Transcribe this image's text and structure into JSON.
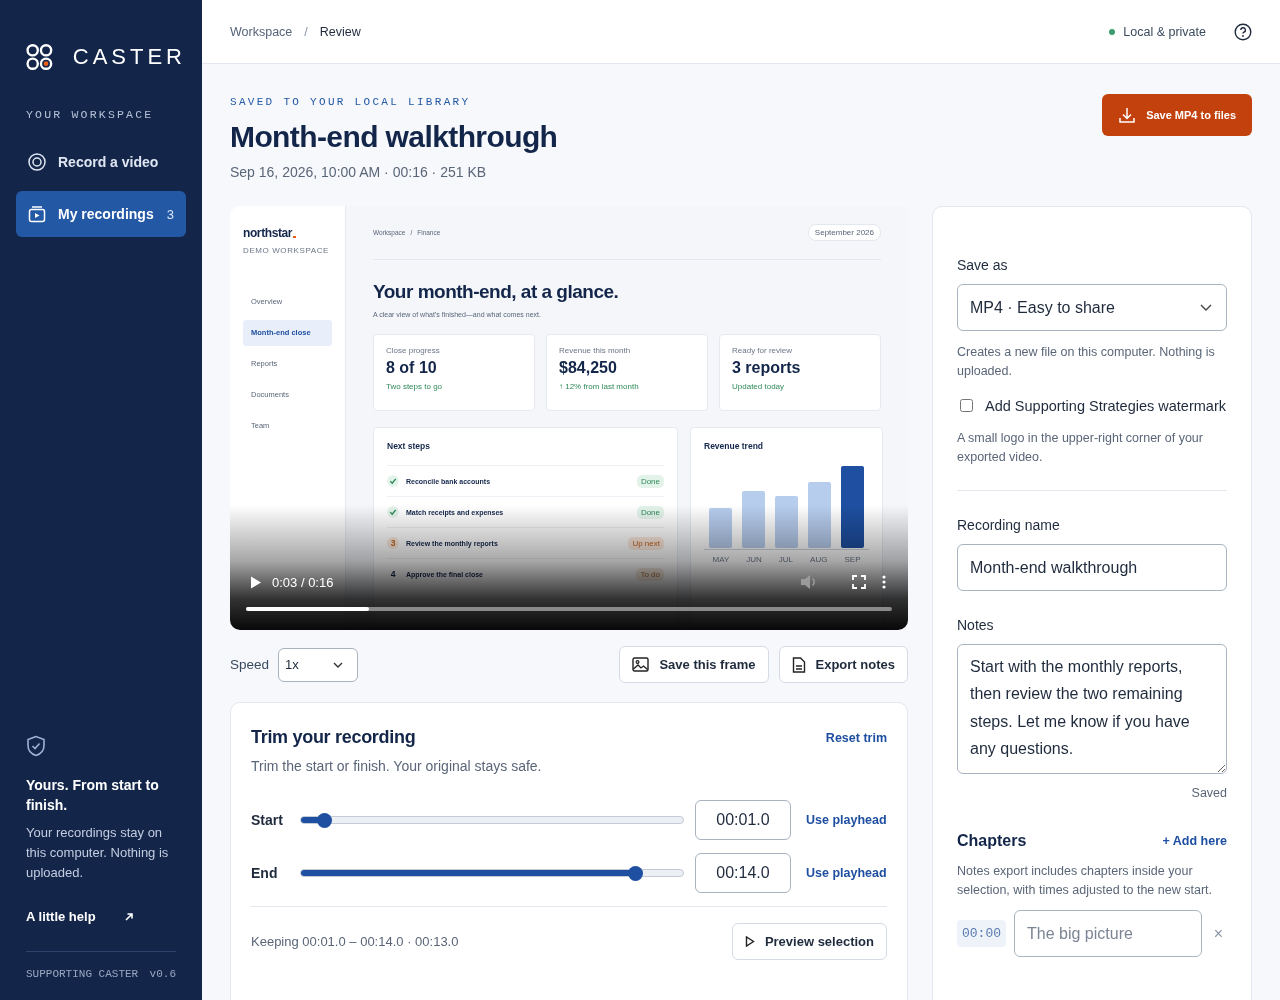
{
  "sidebar": {
    "brand": "CASTER",
    "section_label": "YOUR WORKSPACE",
    "nav": [
      {
        "label": "Record a video",
        "kind": "record",
        "selected": false
      },
      {
        "label": "My recordings",
        "kind": "recordings",
        "selected": true,
        "count": "3"
      }
    ],
    "promo": {
      "title": "Yours. From start to finish.",
      "body": "Your recordings stay on this computer. Nothing is uploaded."
    },
    "help_link": "A little help",
    "footer": {
      "label": "SUPPORTING CASTER",
      "version": "v0.6"
    }
  },
  "header": {
    "breadcrumb": [
      {
        "label": "Workspace",
        "current": false
      },
      {
        "label": "Review",
        "current": true
      }
    ],
    "separator": "/",
    "status": "Local & private"
  },
  "recording": {
    "eyebrow": "SAVED TO YOUR LOCAL LIBRARY",
    "title": "Month-end walkthrough",
    "meta": "Sep 16, 2026, 10:00 AM · 00:16 · 251 KB",
    "save_button": "Save MP4 to files"
  },
  "video": {
    "screen": {
      "brand": "northstar",
      "workspace": "DEMO WORKSPACE",
      "nav": [
        {
          "label": "Overview",
          "selected": false
        },
        {
          "label": "Month-end close",
          "selected": true
        },
        {
          "label": "Reports",
          "selected": false
        },
        {
          "label": "Documents",
          "selected": false
        },
        {
          "label": "Team",
          "selected": false
        }
      ],
      "breadcrumb": [
        "Workspace",
        "Finance"
      ],
      "separator": "/",
      "period": "September 2026",
      "heading": "Your month-end, at a glance.",
      "subheading": "A clear view of what’s finished—and what comes next.",
      "stats": [
        {
          "label": "Close progress",
          "value": "8 of 10",
          "note": "Two steps to go"
        },
        {
          "label": "Revenue this month",
          "value": "$84,250",
          "note": "↑ 12% from last month"
        },
        {
          "label": "Ready for review",
          "value": "3 reports",
          "note": "Updated today"
        }
      ],
      "steps_title": "Next steps",
      "steps": [
        {
          "kind": "done",
          "label": "Reconcile bank accounts",
          "badge": "Done"
        },
        {
          "kind": "done",
          "label": "Match receipts and expenses",
          "badge": "Done"
        },
        {
          "kind": "next",
          "number": "3",
          "label": "Review the monthly reports",
          "badge": "Up next"
        },
        {
          "kind": "todo",
          "number": "4",
          "label": "Approve the final close",
          "badge": "To do"
        }
      ],
      "trend_title": "Revenue trend",
      "months": [
        "MAY",
        "JUN",
        "JUL",
        "AUG",
        "SEP"
      ]
    },
    "player": {
      "time": "0:03 / 0:16",
      "level": 0.19
    }
  },
  "speed": {
    "label": "Speed",
    "value": "1x"
  },
  "actions": [
    {
      "kind": "frame",
      "label": "Save this frame"
    },
    {
      "kind": "notes",
      "label": "Export notes"
    }
  ],
  "trim": {
    "title": "Trim your recording",
    "reset": "Reset trim",
    "subtitle": "Trim the start or finish. Your original stays safe.",
    "rows": [
      {
        "label": "Start",
        "level": 0.0625,
        "value": "00:01.0",
        "action": "Use playhead"
      },
      {
        "label": "End",
        "level": 0.875,
        "value": "00:14.0",
        "action": "Use playhead"
      }
    ],
    "summary": "Keeping 00:01.0 – 00:14.0 · 00:13.0",
    "preview_button": "Preview selection"
  },
  "export_panel": {
    "save_as_label": "Save as",
    "format": "MP4 · Easy to share",
    "format_help": "Creates a new file on this computer. Nothing is uploaded.",
    "watermark": {
      "label": "Add Supporting Strategies watermark",
      "checked": false
    },
    "watermark_help": "A small logo in the upper-right corner of your exported video.",
    "name_label": "Recording name",
    "name": "Month-end walkthrough",
    "notes_label": "Notes",
    "notes": "Start with the monthly reports, then review the two remaining steps. Let me know if you have any questions.",
    "notes_status": "Saved",
    "chapters_title": "Chapters",
    "add_chapter": "+ Add here",
    "chapters_help": "Notes export includes chapters inside your selection, with times adjusted to the new start.",
    "chapters": [
      {
        "time": "00:00",
        "placeholder": "The big picture",
        "remove": "×"
      }
    ]
  }
}
